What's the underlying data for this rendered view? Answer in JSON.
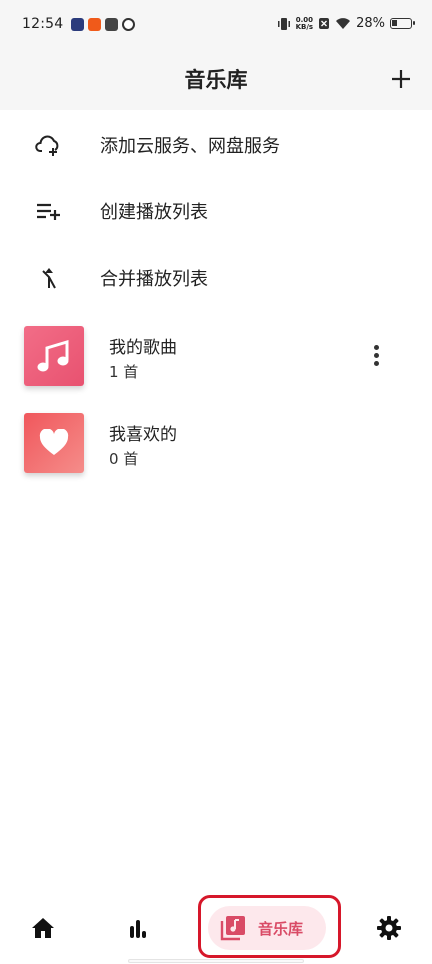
{
  "status_bar": {
    "time": "12:54",
    "net_speed_value": "0.00",
    "net_speed_unit": "KB/s",
    "battery_percent": "28%"
  },
  "header": {
    "title": "音乐库"
  },
  "actions": [
    {
      "label": "添加云服务、网盘服务",
      "icon": "cloud-add-icon"
    },
    {
      "label": "创建播放列表",
      "icon": "playlist-add-icon"
    },
    {
      "label": "合并播放列表",
      "icon": "merge-icon"
    }
  ],
  "playlists": [
    {
      "name": "我的歌曲",
      "count": "1 首",
      "icon": "music-note-icon",
      "color": "#ec5d7b"
    },
    {
      "name": "我喜欢的",
      "count": "0 首",
      "icon": "heart-icon",
      "color": "#f26a6c"
    }
  ],
  "bottom_nav": {
    "active_label": "音乐库",
    "accent": "#d94b66",
    "items": [
      "home-icon",
      "stats-icon",
      "library-icon",
      "settings-icon"
    ]
  }
}
